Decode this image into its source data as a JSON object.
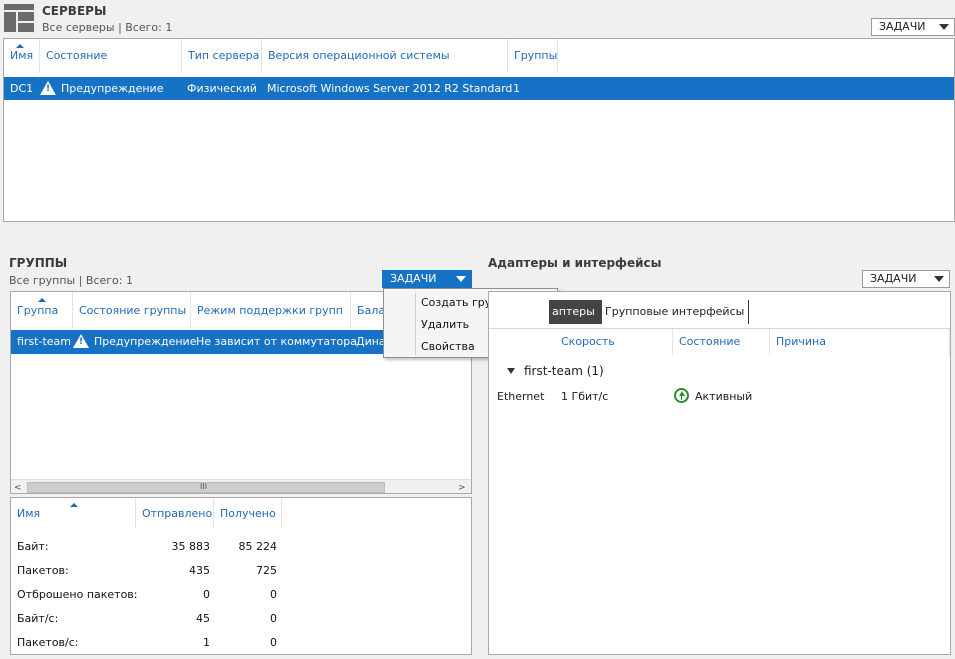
{
  "servers": {
    "title": "СЕРВЕРЫ",
    "subtitle": "Все серверы | Всего: 1",
    "tasks_label": "ЗАДАЧИ",
    "columns": [
      "Имя",
      "Состояние",
      "Тип сервера",
      "Версия операционной системы",
      "Группы"
    ],
    "row": {
      "name": "DC1",
      "state": "Предупреждение",
      "type": "Физический",
      "os": "Microsoft Windows Server 2012 R2 Standard",
      "groups": "1"
    }
  },
  "groups": {
    "title": "ГРУППЫ",
    "subtitle": "Все группы | Всего: 1",
    "tasks_label": "ЗАДАЧИ",
    "columns": [
      "Группа",
      "Состояние группы",
      "Режим поддержки групп",
      "Бала"
    ],
    "row": {
      "name": "first-team",
      "state": "Предупреждение",
      "mode": "Не зависит от коммутатора",
      "balance": "Дина"
    },
    "scroll_grip": "III",
    "menu": [
      "Создать группу",
      "Удалить",
      "Свойства"
    ]
  },
  "stats": {
    "columns": [
      "Имя",
      "Отправлено",
      "Получено"
    ],
    "rows": [
      {
        "label": "Байт:",
        "sent": "35 883",
        "recv": "85 224"
      },
      {
        "label": "Пакетов:",
        "sent": "435",
        "recv": "725"
      },
      {
        "label": "Отброшено пакетов:",
        "sent": "0",
        "recv": "0"
      },
      {
        "label": "Байт/с:",
        "sent": "45",
        "recv": "0"
      },
      {
        "label": "Пакетов/с:",
        "sent": "1",
        "recv": "0"
      }
    ]
  },
  "adapters": {
    "title": "Адаптеры и интерфейсы",
    "tasks_label": "ЗАДАЧИ",
    "tabs": [
      "аптеры",
      "Групповые интерфейсы"
    ],
    "columns": [
      "Скорость",
      "Состояние",
      "Причина"
    ],
    "group_label": "first-team (1)",
    "row": {
      "name": "Ethernet",
      "speed": "1 Гбит/с",
      "state": "Активный"
    }
  },
  "colors": {
    "accent": "#1672c4",
    "header_text": "#1f6ab8",
    "active_green": "#2e8b2e"
  }
}
